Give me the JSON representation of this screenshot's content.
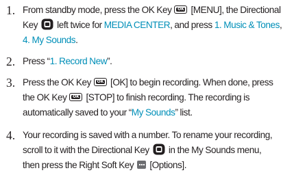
{
  "steps": [
    {
      "number": "1.",
      "lines": [
        {
          "a": "From standby mode, press the OK Key",
          "b": "[MENU], the Directional"
        },
        {
          "a": "Key",
          "b": "left twice for",
          "c": "MEDIA CENTER",
          "d": ", and press",
          "e": "1. Music & Tones",
          "f": ","
        },
        {
          "a": "4. My Sounds",
          "b": "."
        }
      ]
    },
    {
      "number": "2.",
      "lines": [
        {
          "a": "Press “",
          "b": "1. Record New",
          "c": "”."
        }
      ]
    },
    {
      "number": "3.",
      "lines": [
        {
          "a": "Press the OK Key",
          "b": "[OK] to begin recording. When done, press"
        },
        {
          "a": "the OK Key",
          "b": "[STOP] to finish recording. The recording is"
        },
        {
          "a": "automatically saved to your “",
          "b": "My Sounds",
          "c": "” list."
        }
      ]
    },
    {
      "number": "4.",
      "lines": [
        {
          "a": "Your recording is saved with a number. To rename your recording,"
        },
        {
          "a": "scroll to it with the Directional Key",
          "b": "in the My Sounds menu,"
        },
        {
          "a": "then press the Right Soft Key",
          "b": "[Options]."
        }
      ]
    }
  ],
  "icons": {
    "ok_key_label": "OK"
  },
  "colors": {
    "text": "#231f20",
    "highlight": "#008fb8"
  }
}
